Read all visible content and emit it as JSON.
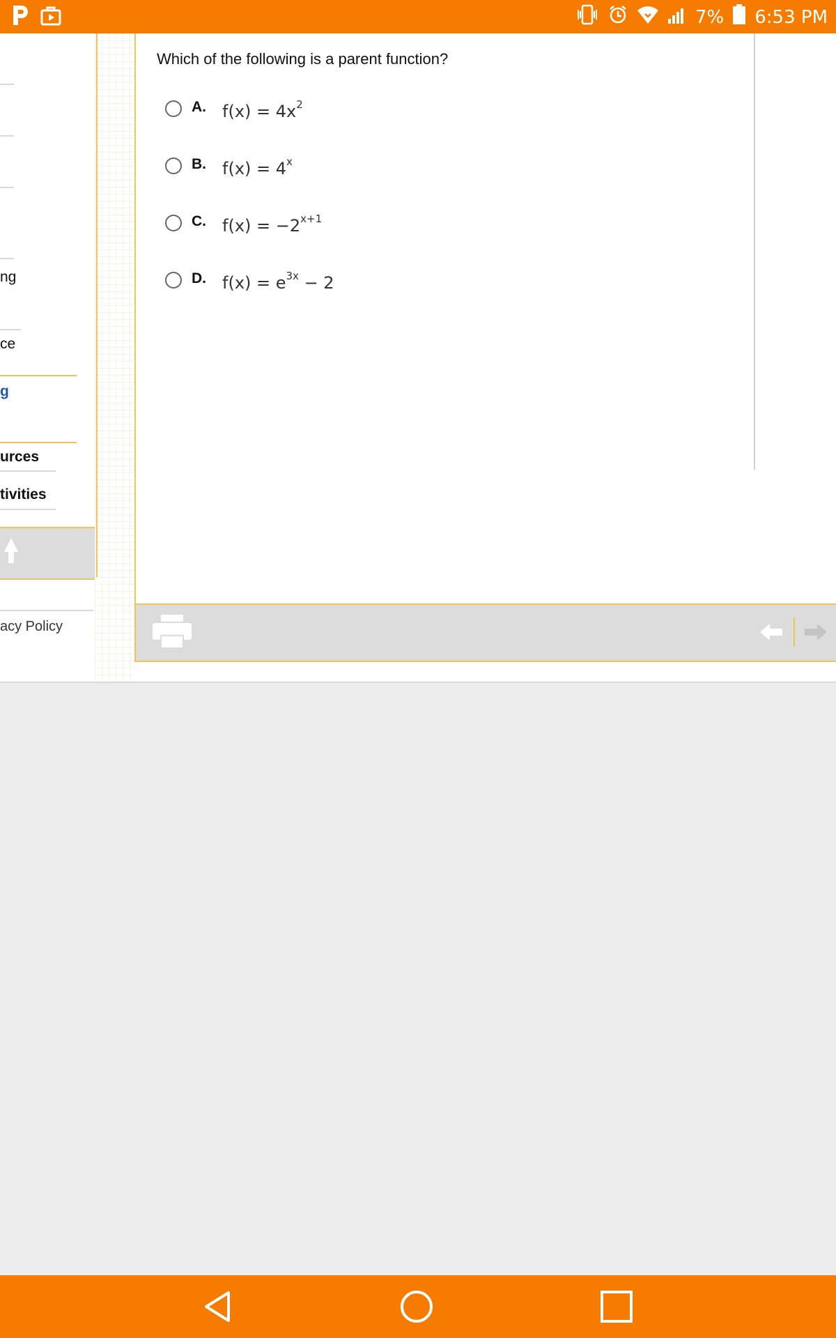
{
  "status_bar": {
    "battery": "7%",
    "time": "6:53 PM"
  },
  "sidebar": {
    "items": [
      "ng",
      "ce",
      "g",
      "urces",
      "tivities"
    ],
    "privacy": "acy Policy"
  },
  "question": {
    "text": "Which of the following is a parent function?",
    "options": [
      {
        "letter": "A.",
        "lhs": "f(x) = 4x",
        "sup": "2",
        "rhs": ""
      },
      {
        "letter": "B.",
        "lhs": "f(x) = 4",
        "sup": "x",
        "rhs": ""
      },
      {
        "letter": "C.",
        "lhs": "f(x) = −2",
        "sup": "x+1",
        "rhs": ""
      },
      {
        "letter": "D.",
        "lhs": "f(x) = e",
        "sup": "3x",
        "rhs": " − 2"
      }
    ]
  },
  "colors": {
    "accent": "#f57c00",
    "border": "#f0c45a",
    "toolbar": "#dcdcdc"
  }
}
